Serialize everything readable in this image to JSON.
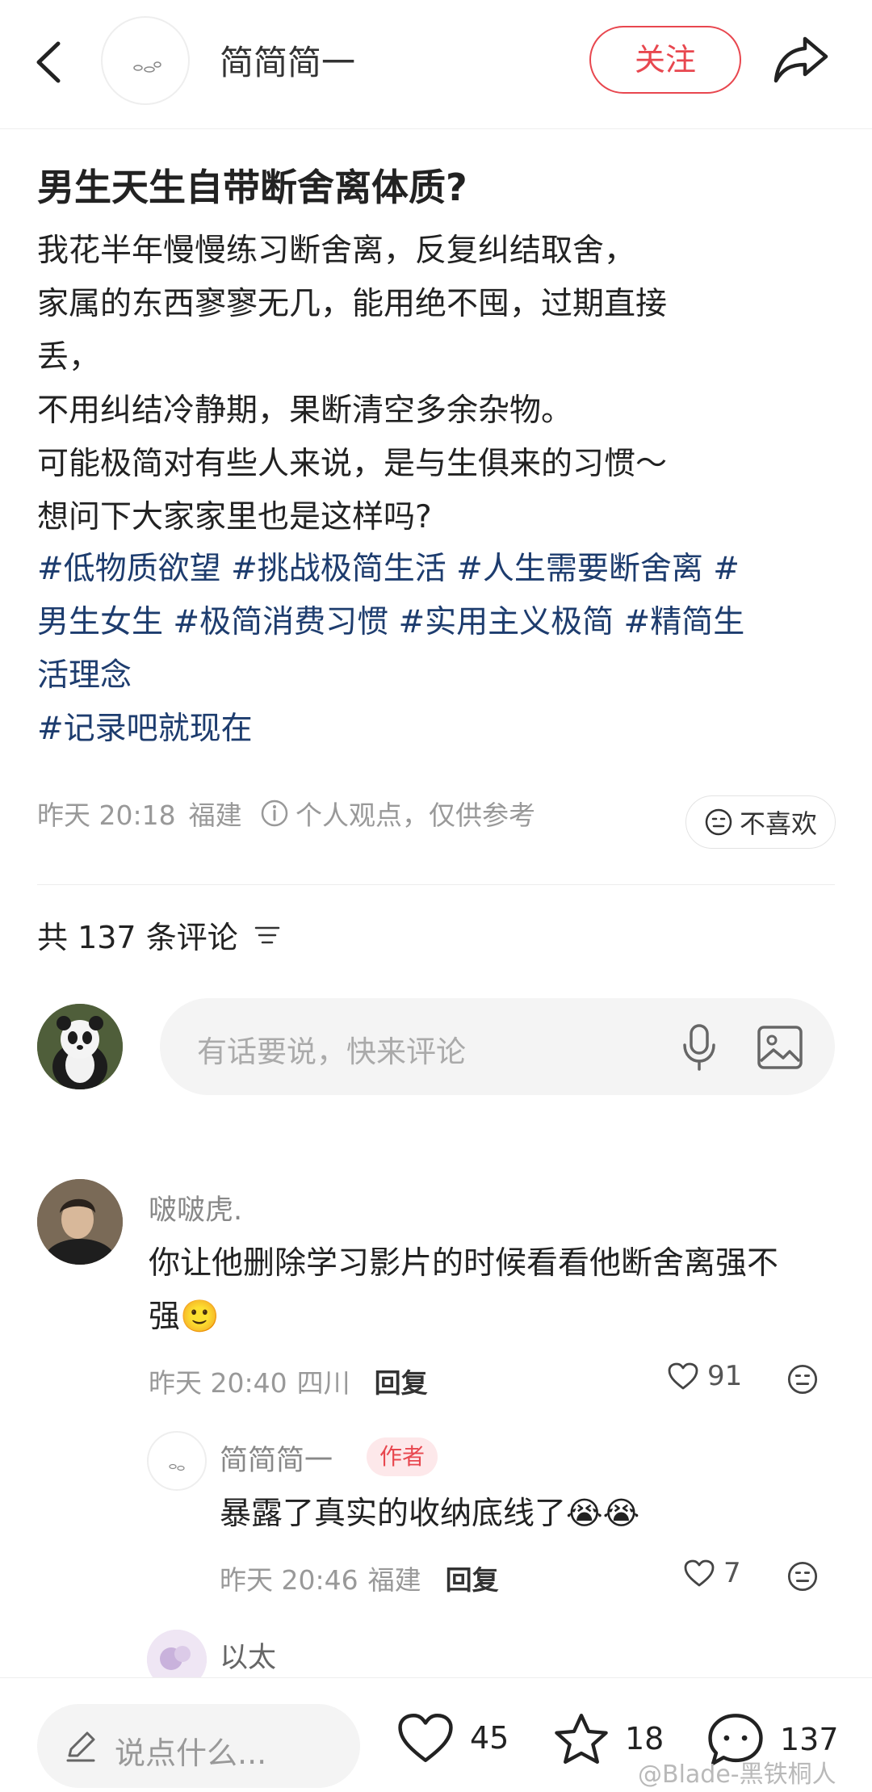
{
  "header": {
    "author_name": "简简简一",
    "follow_label": "关注"
  },
  "post": {
    "title": "男生天生自带断舍离体质?",
    "body_lines": [
      "我花半年慢慢练习断舍离，反复纠结取舍，",
      "家属的东西寥寥无几，能用绝不囤，过期直接",
      "丢，",
      "不用纠结冷静期，果断清空多余杂物。",
      "可能极简对有些人来说，是与生俱来的习惯～",
      "想问下大家家里也是这样吗?"
    ],
    "tag_lines": [
      "#低物质欲望 #挑战极简生活 #人生需要断舍离 #",
      "男生女生 #极简消费习惯 #实用主义极简 #精简生",
      "活理念",
      "#记录吧就现在"
    ],
    "time": "昨天 20:18",
    "location": "福建",
    "disclaimer": "个人观点，仅供参考",
    "dislike_label": "不喜欢"
  },
  "comments_header": {
    "count_label": "共 137 条评论"
  },
  "composer": {
    "placeholder": "有话要说，快来评论"
  },
  "comments": [
    {
      "name": "啵啵虎.",
      "text_line1": "你让他删除学习影片的时候看看他断舍离强不",
      "text_line2": "强",
      "emoji": "🙂",
      "time": "昨天 20:40",
      "location": "四川",
      "reply_label": "回复",
      "likes": "91"
    },
    {
      "name": "简简简一",
      "badge": "作者",
      "text": "暴露了真实的收纳底线了",
      "emoji": "😭😭",
      "time": "昨天 20:46",
      "location": "福建",
      "reply_label": "回复",
      "likes": "7"
    },
    {
      "name": "以太"
    }
  ],
  "bottom_bar": {
    "input_placeholder": "说点什么...",
    "likes": "45",
    "favorites": "18",
    "comments": "137"
  },
  "watermark": "@Blade-黑铁桐人",
  "colors": {
    "accent": "#e8474f",
    "tag": "#1d3c6e",
    "muted": "#999999"
  }
}
